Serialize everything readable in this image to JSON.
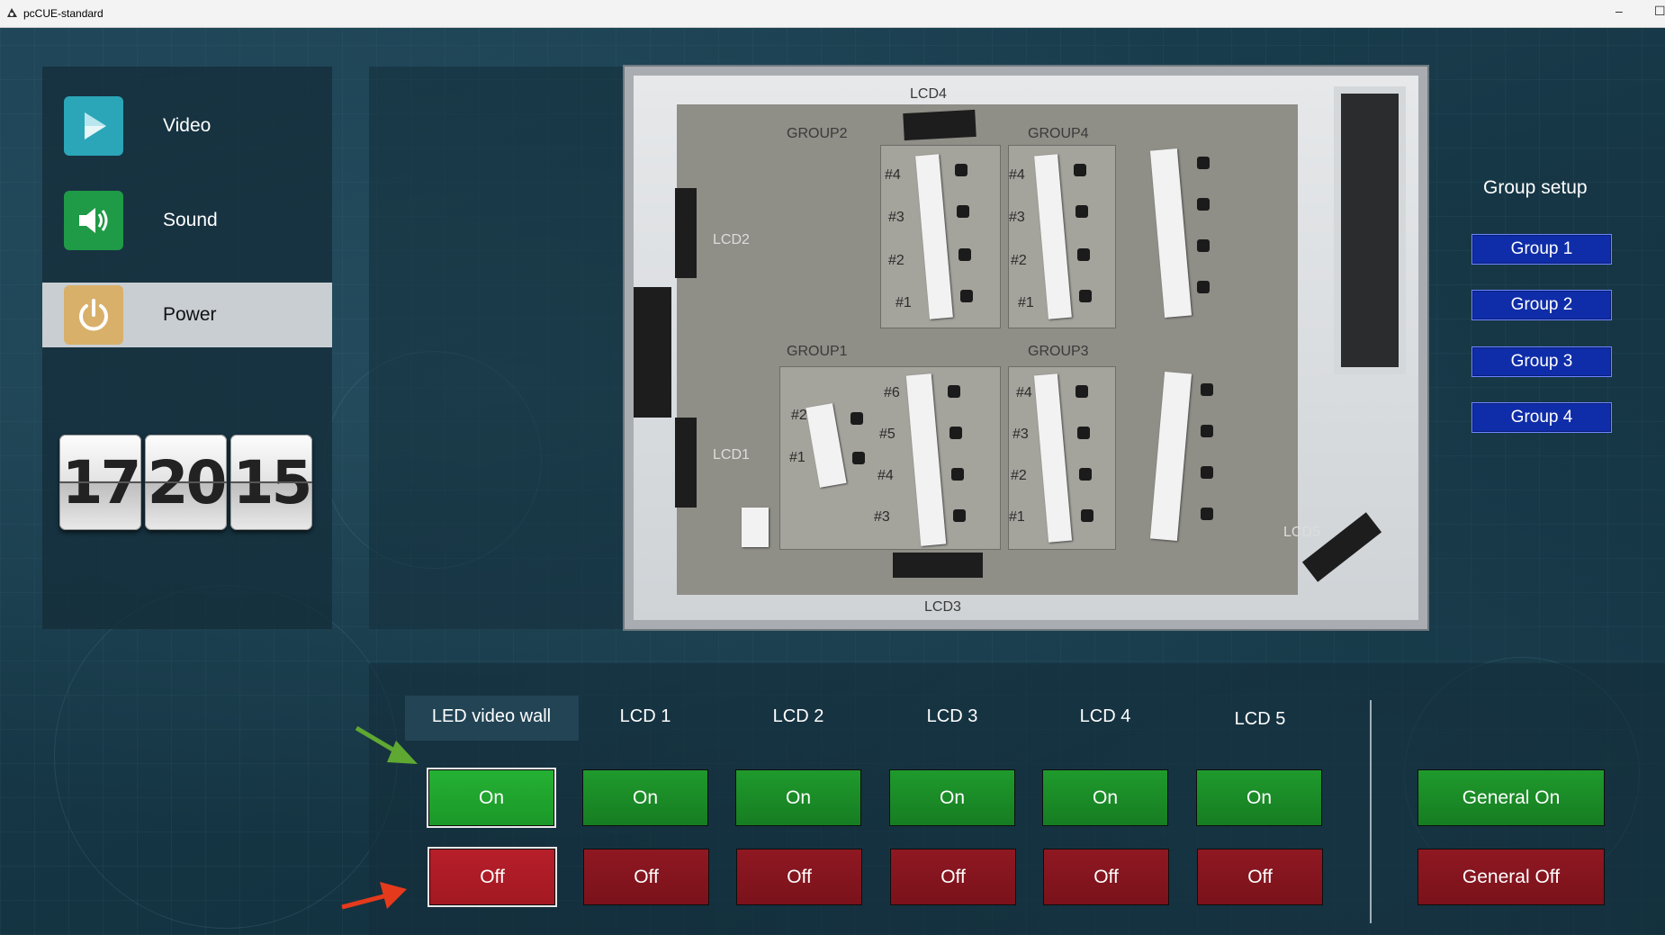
{
  "window": {
    "title": "pcCUE-standard",
    "minimize": "–",
    "maximize": "☐"
  },
  "nav": [
    {
      "label": "Video",
      "icon": "play-icon",
      "color": "#2aa6b8"
    },
    {
      "label": "Sound",
      "icon": "speaker-icon",
      "color": "#1f9a46"
    },
    {
      "label": "Power",
      "icon": "power-icon",
      "color": "#d9b06a",
      "active": true
    }
  ],
  "clock": {
    "hours": "17",
    "minutes": "20",
    "seconds": "15"
  },
  "floorplan": {
    "screens": [
      "LCD4",
      "LCD2",
      "LCD1",
      "LCD3",
      "LCD5"
    ],
    "groups": [
      "GROUP2",
      "GROUP4",
      "GROUP1",
      "GROUP3"
    ],
    "seats": {
      "group2": [
        "#4",
        "#3",
        "#2",
        "#1"
      ],
      "group4": [
        "#4",
        "#3",
        "#2",
        "#1"
      ],
      "group1_left": [
        "#2",
        "#1"
      ],
      "group1_right": [
        "#6",
        "#5",
        "#4",
        "#3"
      ],
      "group3": [
        "#4",
        "#3",
        "#2",
        "#1"
      ]
    }
  },
  "group_setup": {
    "title": "Group setup",
    "buttons": [
      "Group 1",
      "Group 2",
      "Group 3",
      "Group 4"
    ]
  },
  "controls": {
    "columns": [
      "LED video wall",
      "LCD 1",
      "LCD 2",
      "LCD 3",
      "LCD 4",
      "LCD 5"
    ],
    "on_label": "On",
    "off_label": "Off",
    "general_on": "General On",
    "general_off": "General Off"
  },
  "colors": {
    "on": "#1f9a2c",
    "off": "#8f1822",
    "group_btn": "#0f2da8",
    "green_arrow": "#5fa832",
    "red_arrow": "#e53a1c"
  }
}
